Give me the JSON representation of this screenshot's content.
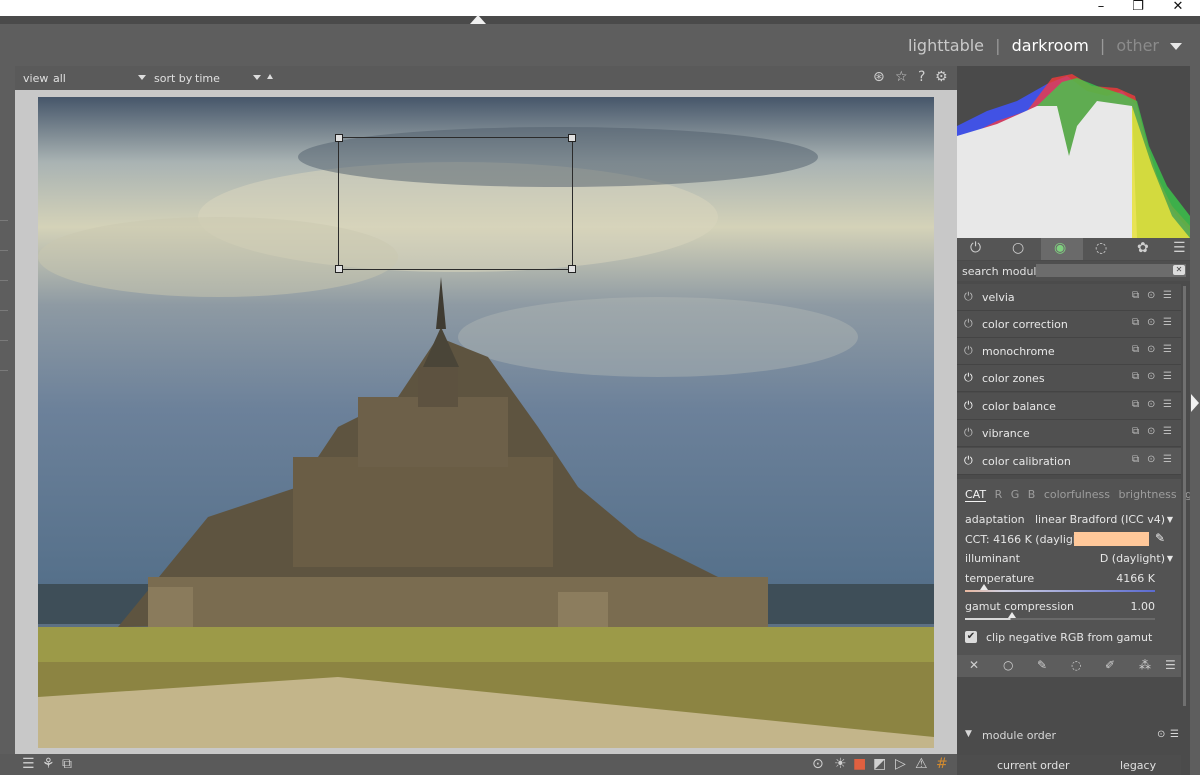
{
  "window": {
    "minimize": "–",
    "restore": "❐",
    "close": "✕"
  },
  "header": {
    "views": [
      {
        "label": "lighttable"
      },
      {
        "label": "darkroom"
      },
      {
        "label": "other"
      }
    ],
    "separator": "|"
  },
  "filterbar": {
    "view_label": "view",
    "view_value": "all",
    "sort_label": "sort by",
    "sort_value": "time"
  },
  "right_panel": {
    "search_label": "search module",
    "modules": [
      {
        "name": "velvia",
        "on": false
      },
      {
        "name": "color correction",
        "on": false
      },
      {
        "name": "monochrome",
        "on": false
      },
      {
        "name": "color zones",
        "on": true
      },
      {
        "name": "color balance",
        "on": true
      },
      {
        "name": "vibrance",
        "on": false
      },
      {
        "name": "color calibration",
        "on": true
      }
    ],
    "color_calibration": {
      "tabs": [
        "CAT",
        "R",
        "G",
        "B",
        "colorfulness",
        "brightness",
        "grey"
      ],
      "adaptation_label": "adaptation",
      "adaptation_value": "linear Bradford (ICC v4)",
      "cct_label": "CCT: 4166 K (daylight)",
      "swatch_color": "#ffc89a",
      "illuminant_label": "illuminant",
      "illuminant_value": "D (daylight)",
      "temperature_label": "temperature",
      "temperature_value": "4166 K",
      "gamut_label": "gamut compression",
      "gamut_value": "1.00",
      "clip_label": "clip negative RGB from gamut",
      "clip_checked": true
    },
    "module_order_label": "module order",
    "current_order_label": "current order",
    "current_order_value": "legacy"
  }
}
